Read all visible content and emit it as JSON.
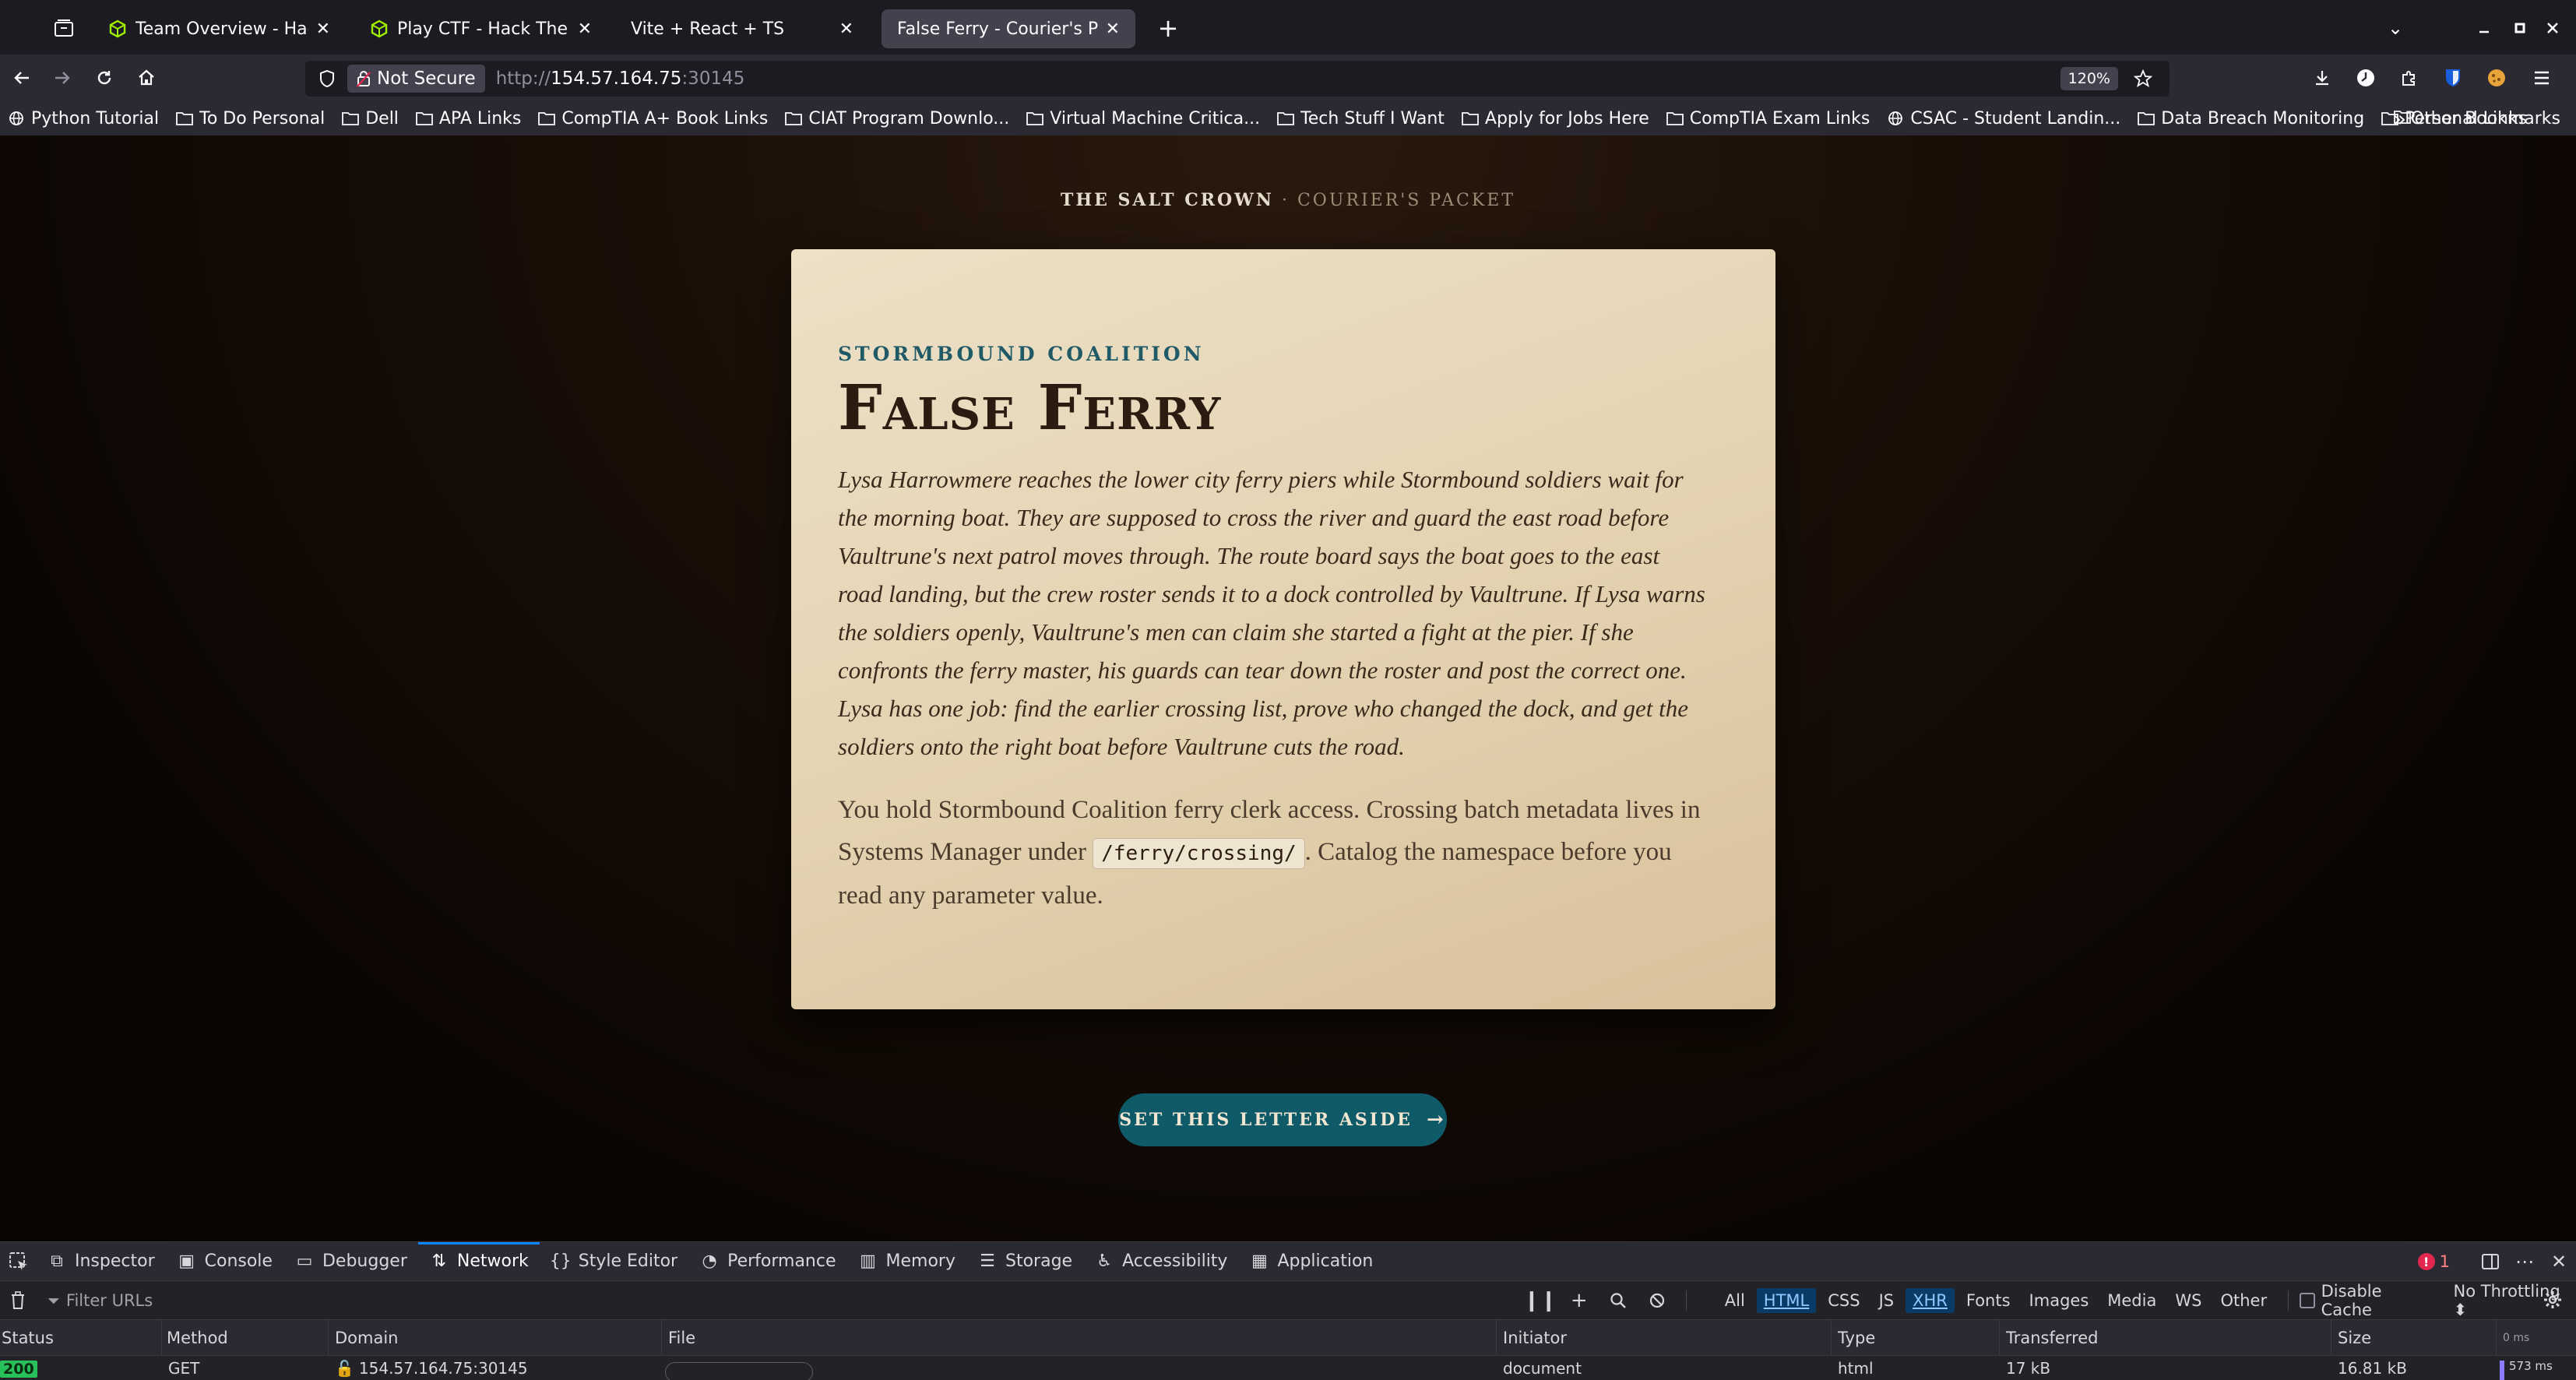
{
  "browser": {
    "tabs": [
      {
        "title": "Team Overview - Hack Th",
        "icon": "htb-cube-icon",
        "active": false
      },
      {
        "title": "Play CTF - Hack The Box C",
        "icon": "htb-cube-icon",
        "active": false
      },
      {
        "title": "Vite + React + TS",
        "icon": "",
        "active": false
      },
      {
        "title": "False Ferry - Courier's Packet",
        "icon": "",
        "active": true
      }
    ],
    "new_tab_label": "+",
    "security_label": "Not Secure",
    "url_prefix": "http://",
    "url_host": "154.57.164.75",
    "url_port": ":30145",
    "zoom": "120%",
    "bookmarks": [
      {
        "label": "Python Tutorial",
        "icon": "globe-icon"
      },
      {
        "label": "To Do Personal",
        "icon": "folder-icon"
      },
      {
        "label": "Dell",
        "icon": "folder-icon"
      },
      {
        "label": "APA Links",
        "icon": "folder-icon"
      },
      {
        "label": "CompTIA A+ Book Links",
        "icon": "folder-icon"
      },
      {
        "label": "CIAT Program Downlo...",
        "icon": "folder-icon"
      },
      {
        "label": "Virtual Machine Critica...",
        "icon": "folder-icon"
      },
      {
        "label": "Tech Stuff I Want",
        "icon": "folder-icon"
      },
      {
        "label": "Apply for Jobs Here",
        "icon": "folder-icon"
      },
      {
        "label": "CompTIA Exam Links",
        "icon": "folder-icon"
      },
      {
        "label": "CSAC - Student Landin...",
        "icon": "globe-icon"
      },
      {
        "label": "Data Breach Monitoring",
        "icon": "folder-icon"
      },
      {
        "label": "Personal Links",
        "icon": "folder-icon"
      }
    ],
    "other_bookmarks": "Other Bookmarks"
  },
  "page": {
    "header_brand": "THE SALT CROWN",
    "header_sep": " · ",
    "header_sub": "COURIER'S PACKET",
    "eyebrow": "STORMBOUND COALITION",
    "title": "False Ferry",
    "story": "Lysa Harrowmere reaches the lower city ferry piers while Stormbound soldiers wait for the morning boat. They are supposed to cross the river and guard the east road before Vaultrune's next patrol moves through. The route board says the boat goes to the east road landing, but the crew roster sends it to a dock controlled by Vaultrune. If Lysa warns the soldiers openly, Vaultrune's men can claim she started a fight at the pier. If she confronts the ferry master, his guards can tear down the roster and post the correct one. Lysa has one job: find the earlier crossing list, prove who changed the dock, and get the soldiers onto the right boat before Vaultrune cuts the road.",
    "instructions_before": "You hold Stormbound Coalition ferry clerk access. Crossing batch metadata lives in Systems Manager under ",
    "instructions_code": "/ferry/crossing/",
    "instructions_after": ". Catalog the namespace before you read any parameter value.",
    "cta_label": "SET THIS LETTER ASIDE",
    "colors": {
      "accent": "#0f5a68",
      "eyebrow": "#1f5a66",
      "paper": "#e4d3b2"
    }
  },
  "devtools": {
    "tabs": [
      {
        "label": "Inspector",
        "icon": "inspector-icon"
      },
      {
        "label": "Console",
        "icon": "console-icon"
      },
      {
        "label": "Debugger",
        "icon": "debugger-icon"
      },
      {
        "label": "Network",
        "icon": "network-icon",
        "active": true
      },
      {
        "label": "Style Editor",
        "icon": "style-editor-icon"
      },
      {
        "label": "Performance",
        "icon": "performance-icon"
      },
      {
        "label": "Memory",
        "icon": "memory-icon"
      },
      {
        "label": "Storage",
        "icon": "storage-icon"
      },
      {
        "label": "Accessibility",
        "icon": "accessibility-icon"
      },
      {
        "label": "Application",
        "icon": "application-icon"
      }
    ],
    "error_count": "1",
    "filter_placeholder": "Filter URLs",
    "types": [
      "All",
      "HTML",
      "CSS",
      "JS",
      "XHR",
      "Fonts",
      "Images",
      "Media",
      "WS",
      "Other"
    ],
    "active_types": [
      "HTML",
      "XHR"
    ],
    "disable_cache": "Disable Cache",
    "throttling": "No Throttling",
    "columns": [
      "Status",
      "Method",
      "Domain",
      "File",
      "Initiator",
      "Type",
      "Transferred",
      "Size"
    ],
    "timeline_label": "0 ms",
    "row": {
      "status": "200",
      "method": "GET",
      "domain": "154.57.164.75:30145",
      "initiator": "document",
      "type": "html",
      "transferred": "17 kB",
      "size": "16.81 kB",
      "timing": "573 ms"
    }
  }
}
